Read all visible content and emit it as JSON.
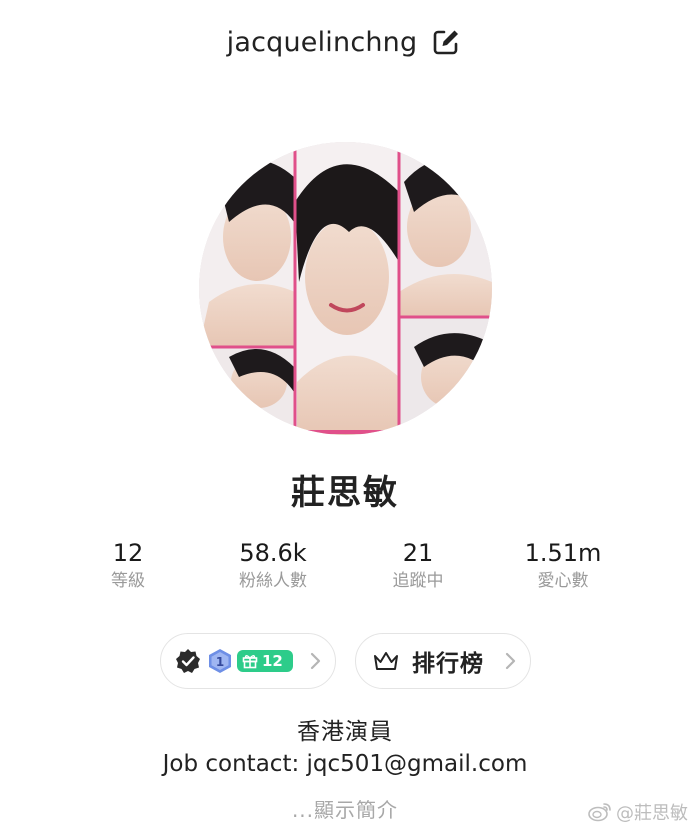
{
  "header": {
    "username": "jacquelinchng",
    "edit_icon": "edit-icon"
  },
  "profile": {
    "display_name": "莊思敏"
  },
  "stats": [
    {
      "value": "12",
      "label": "等級"
    },
    {
      "value": "58.6k",
      "label": "粉絲人數"
    },
    {
      "value": "21",
      "label": "追蹤中"
    },
    {
      "value": "1.51m",
      "label": "愛心數"
    }
  ],
  "badges": {
    "verified_icon": "verified-icon",
    "level_badge": "1",
    "gift_count": "12"
  },
  "ranking": {
    "label": "排行榜",
    "icon": "crown-icon"
  },
  "bio": {
    "line1": "香港演員",
    "line2": "Job contact: jqc501@gmail.com",
    "show_more": "...顯示簡介"
  },
  "watermark": {
    "text": "@莊思敏"
  },
  "colors": {
    "gift_badge": "#2dcc8a",
    "level_badge": "#6e8fe6",
    "muted_text": "#9a9a9a",
    "collage_border": "#e0508a"
  }
}
